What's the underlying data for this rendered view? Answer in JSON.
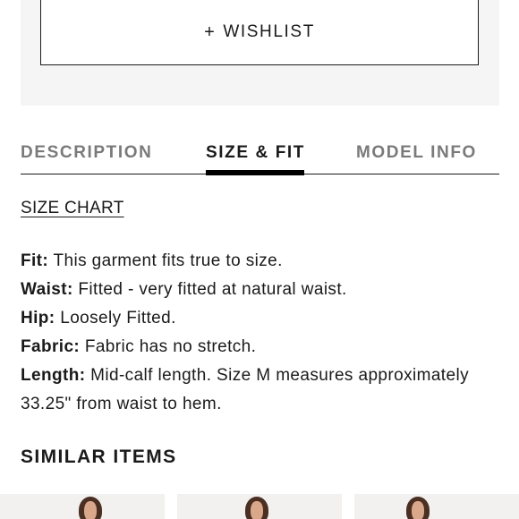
{
  "wishlist": {
    "plus": "+",
    "label": "WISHLIST"
  },
  "tabs": [
    {
      "label": "DESCRIPTION",
      "active": false
    },
    {
      "label": "SIZE & FIT",
      "active": true
    },
    {
      "label": "MODEL INFO",
      "active": false
    }
  ],
  "size_chart_link": "SIZE CHART",
  "details": [
    {
      "label": "Fit:",
      "text": " This garment fits true to size."
    },
    {
      "label": "Waist:",
      "text": " Fitted - very fitted at natural waist."
    },
    {
      "label": "Hip:",
      "text": " Loosely Fitted."
    },
    {
      "label": "Fabric:",
      "text": " Fabric has no stretch."
    },
    {
      "label": "Length:",
      "text": " Mid-calf length. Size M measures approximately 33.25\" from waist to hem."
    }
  ],
  "similar_items": {
    "title": "SIMILAR ITEMS",
    "count": 3
  },
  "colors": {
    "panel_bg": "#f5f5f5",
    "text": "#1a1a1a",
    "inactive_tab": "#7a7a7a"
  }
}
